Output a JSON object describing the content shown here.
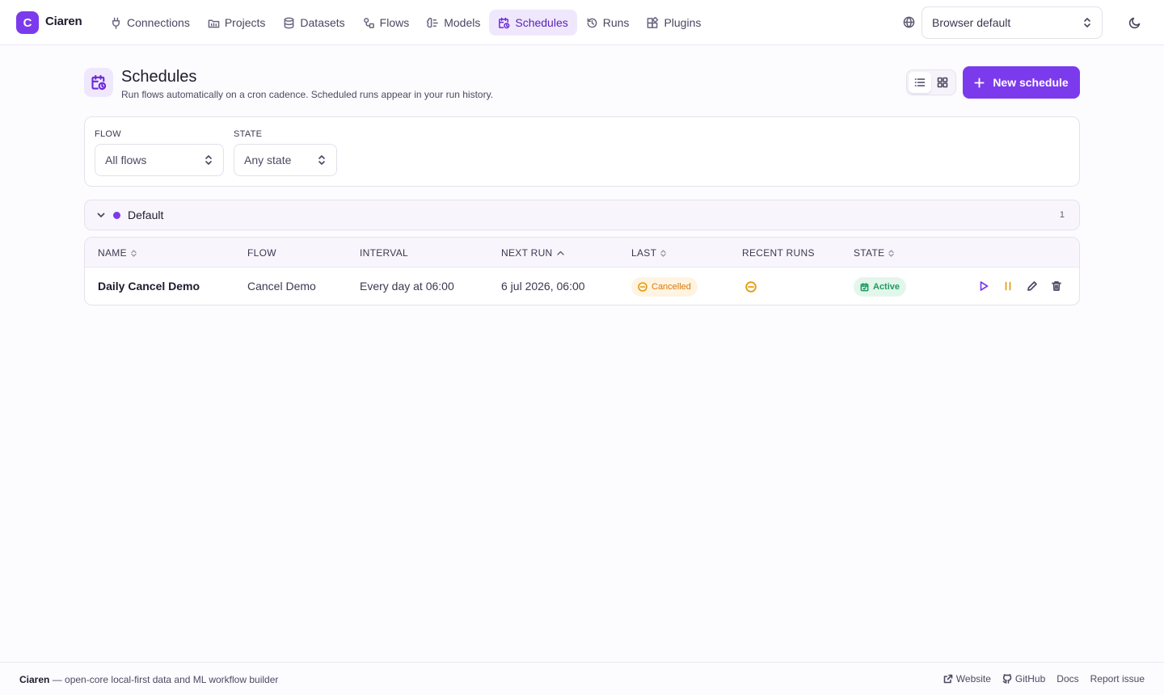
{
  "app": {
    "logo_letter": "C",
    "brand_name": "Ciaren",
    "accent_color": "#7c3aed"
  },
  "nav": {
    "items": [
      {
        "label": "Connections",
        "icon": "plug-icon",
        "active": false
      },
      {
        "label": "Projects",
        "icon": "projects-icon",
        "active": false
      },
      {
        "label": "Datasets",
        "icon": "database-icon",
        "active": false
      },
      {
        "label": "Flows",
        "icon": "flows-icon",
        "active": false
      },
      {
        "label": "Models",
        "icon": "models-icon",
        "active": false
      },
      {
        "label": "Schedules",
        "icon": "calendar-clock-icon",
        "active": true
      },
      {
        "label": "Runs",
        "icon": "history-icon",
        "active": false
      },
      {
        "label": "Plugins",
        "icon": "plugins-icon",
        "active": false
      }
    ],
    "language_select": "Browser default",
    "language_icon": "globe-icon",
    "theme_icon": "moon-icon"
  },
  "header": {
    "title": "Schedules",
    "subtitle": "Run flows automatically on a cron cadence. Scheduled runs appear in your run history.",
    "view_mode": "list",
    "new_button_label": "New schedule"
  },
  "filters": {
    "flow_label": "FLOW",
    "flow_value": "All flows",
    "state_label": "STATE",
    "state_value": "Any state"
  },
  "group": {
    "name": "Default",
    "count": "1",
    "color": "#7c3aed"
  },
  "table": {
    "columns": {
      "name": "NAME",
      "flow": "FLOW",
      "interval": "INTERVAL",
      "next_run": "NEXT RUN",
      "last": "LAST",
      "recent_runs": "RECENT RUNS",
      "state": "STATE"
    },
    "rows": [
      {
        "name": "Daily Cancel Demo",
        "flow": "Cancel Demo",
        "interval": "Every day at 06:00",
        "next_run": "6 jul 2026, 06:00",
        "last": "Cancelled",
        "state": "Active"
      }
    ]
  },
  "footer": {
    "brand": "Ciaren",
    "tagline": " — open-core local-first data and ML workflow builder",
    "links": {
      "website": "Website",
      "github": "GitHub",
      "docs": "Docs",
      "report": "Report issue"
    }
  }
}
